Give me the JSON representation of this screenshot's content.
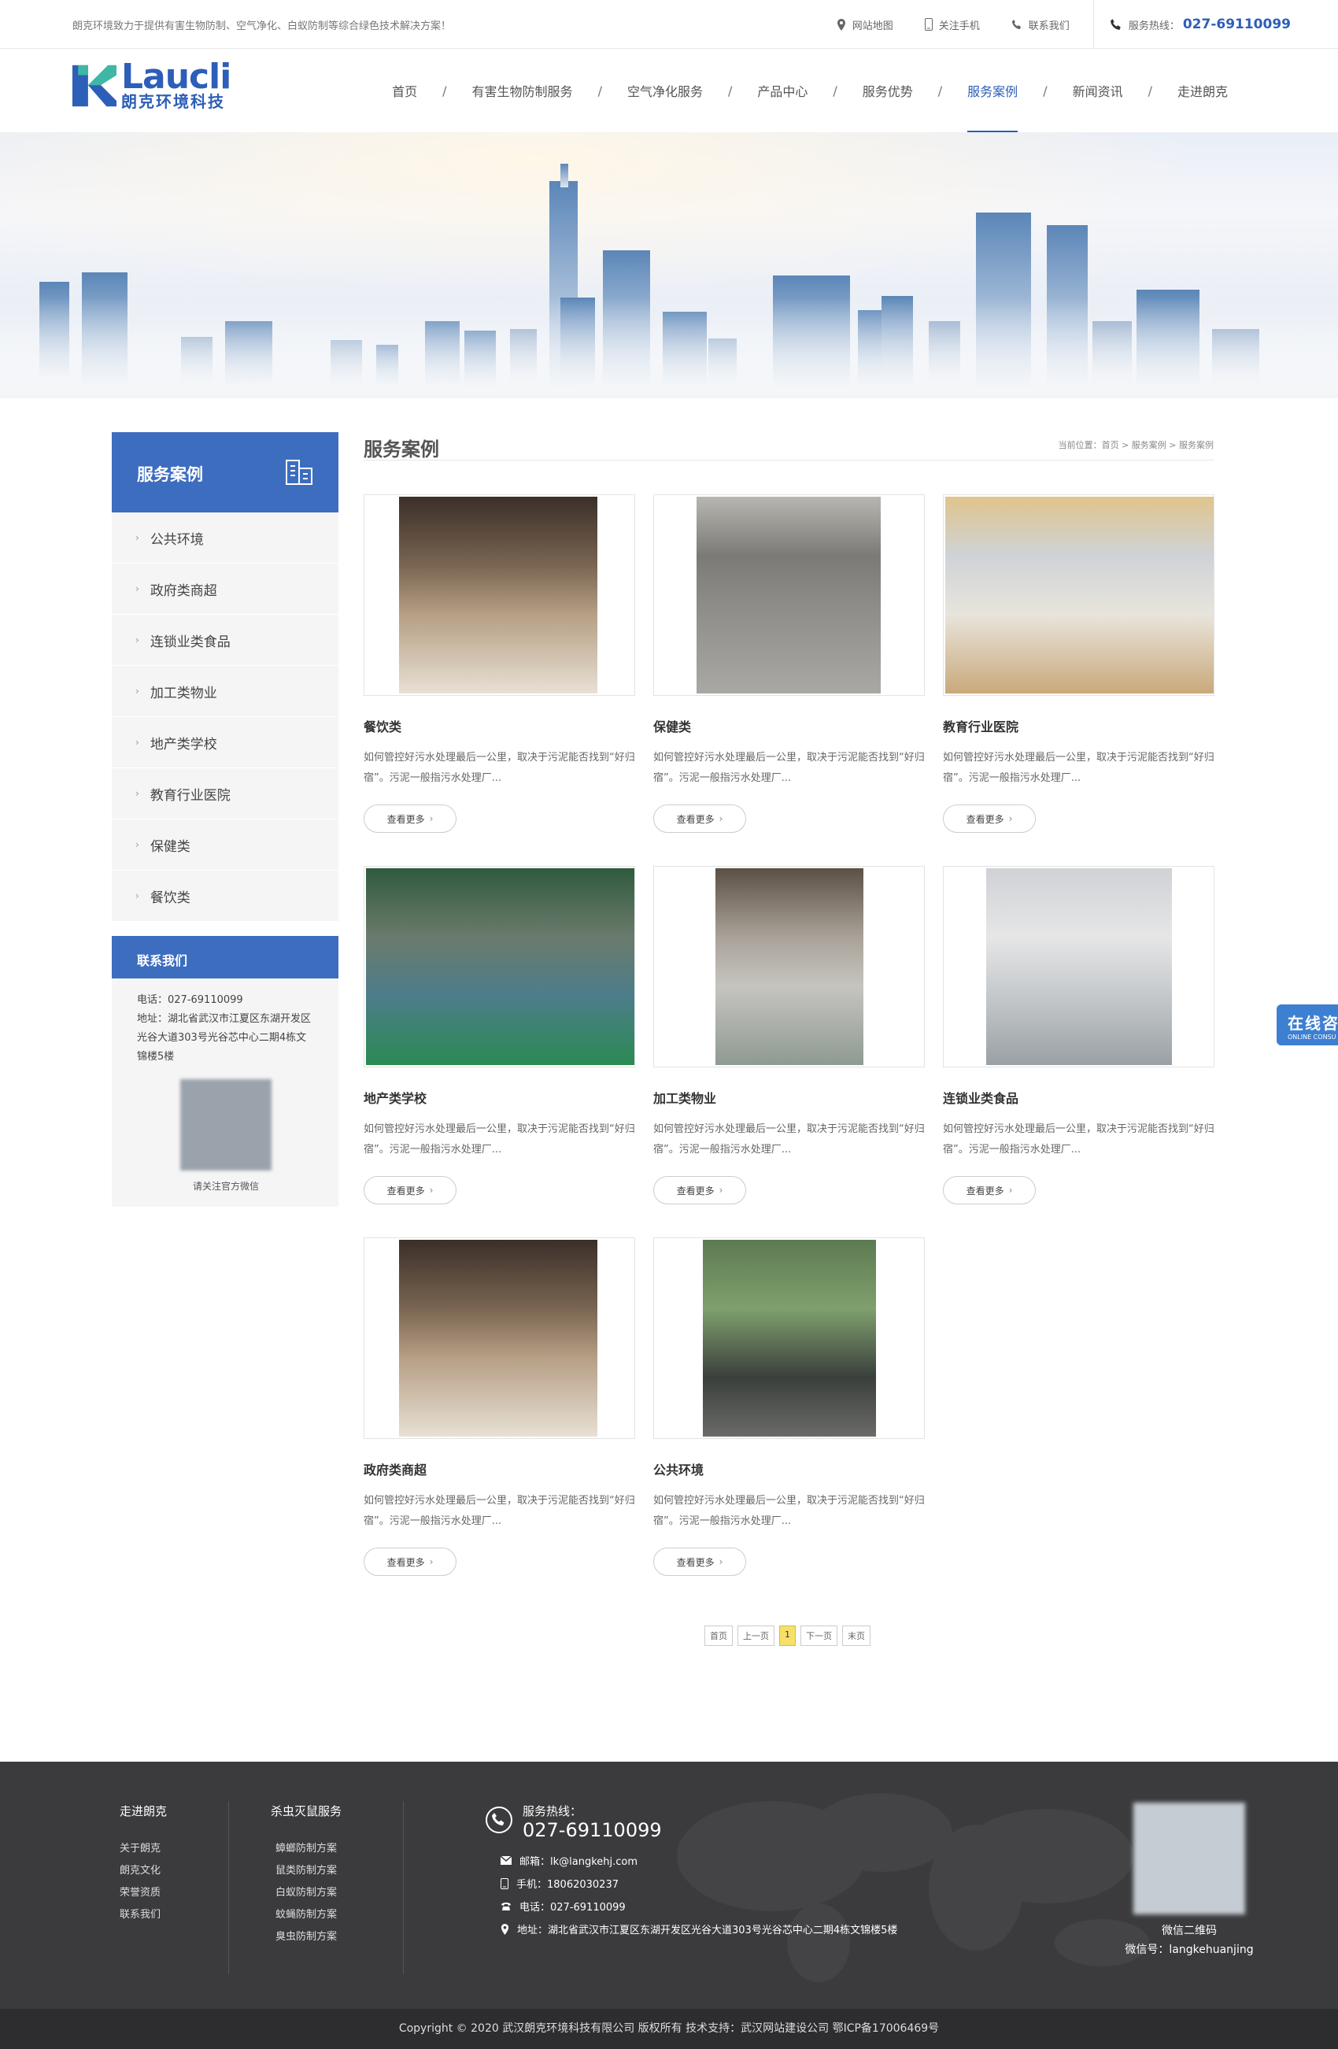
{
  "topbar": {
    "slogan": "朗克环境致力于提供有害生物防制、空气净化、白蚁防制等综合绿色技术解决方案！",
    "sitemap": "网站地图",
    "mobile": "关注手机",
    "contact": "联系我们",
    "hotline_label": "服务热线：",
    "hotline": "027-69110099"
  },
  "logo": {
    "en": "Laucli",
    "cn": "朗克环境科技"
  },
  "nav": [
    "首页",
    "有害生物防制服务",
    "空气净化服务",
    "产品中心",
    "服务优势",
    "服务案例",
    "新闻资讯",
    "走进朗克"
  ],
  "nav_active": "服务案例",
  "sidebar": {
    "title": "服务案例",
    "items": [
      "公共环境",
      "政府类商超",
      "连锁业类食品",
      "加工类物业",
      "地产类学校",
      "教育行业医院",
      "保健类",
      "餐饮类"
    ],
    "contact_title": "联系我们",
    "phone": "电话：027-69110099",
    "address": "地址：湖北省武汉市江夏区东湖开发区光谷大道303号光谷芯中心二期4栋文锦楼5楼",
    "qr_caption": "请关注官方微信"
  },
  "main": {
    "title": "服务案例",
    "breadcrumb": "当前位置：首页 > 服务案例 > 服务案例",
    "more_label": "查看更多",
    "desc": "如何管控好污水处理最后一公里，取决于污泥能否找到“好归宿”。污泥一般指污水处理厂...",
    "cards": [
      {
        "name": "餐饮类"
      },
      {
        "name": "保健类"
      },
      {
        "name": "教育行业医院"
      },
      {
        "name": "地产类学校"
      },
      {
        "name": "加工类物业"
      },
      {
        "name": "连锁业类食品"
      },
      {
        "name": "政府类商超"
      },
      {
        "name": "公共环境"
      }
    ]
  },
  "pager": {
    "first": "首页",
    "prev": "上一页",
    "current": "1",
    "next": "下一页",
    "last": "末页"
  },
  "online": {
    "cn": "在线咨",
    "en": "ONLINE CONSU"
  },
  "footer": {
    "col1_title": "走进朗克",
    "col1": [
      "关于朗克",
      "朗克文化",
      "荣誉资质",
      "联系我们"
    ],
    "col2_title": "杀虫灭鼠服务",
    "col2": [
      "蟑螂防制方案",
      "鼠类防制方案",
      "白蚁防制方案",
      "蚊蝇防制方案",
      "臭虫防制方案"
    ],
    "hot_label": "服务热线：",
    "hot_num": "027-69110099",
    "email": "邮箱：lk@langkehj.com",
    "mobile": "手机：18062030237",
    "tel": "电话：027-69110099",
    "addr": "地址：湖北省武汉市江夏区东湖开发区光谷大道303号光谷芯中心二期4栋文锦楼5楼",
    "qr_caption": "微信二维码",
    "wechat": "微信号：langkehuanjing"
  },
  "copyright": "Copyright © 2020  武汉朗克环境科技有限公司  版权所有 技术支持：武汉网站建设公司  鄂ICP备17006469号",
  "colors": {
    "brand": "#2d5eb8",
    "sidebar": "#3d6dbf",
    "footer": "#3b3b3d"
  }
}
